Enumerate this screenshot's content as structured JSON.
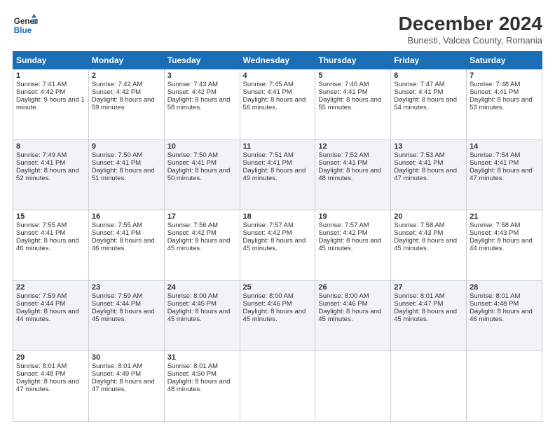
{
  "logo": {
    "line1": "General",
    "line2": "Blue"
  },
  "title": "December 2024",
  "subtitle": "Bunesti, Valcea County, Romania",
  "headers": [
    "Sunday",
    "Monday",
    "Tuesday",
    "Wednesday",
    "Thursday",
    "Friday",
    "Saturday"
  ],
  "weeks": [
    [
      {
        "day": "1",
        "sunrise": "7:41 AM",
        "sunset": "4:42 PM",
        "daylight": "9 hours and 1 minute."
      },
      {
        "day": "2",
        "sunrise": "7:42 AM",
        "sunset": "4:42 PM",
        "daylight": "8 hours and 59 minutes."
      },
      {
        "day": "3",
        "sunrise": "7:43 AM",
        "sunset": "4:42 PM",
        "daylight": "8 hours and 58 minutes."
      },
      {
        "day": "4",
        "sunrise": "7:45 AM",
        "sunset": "4:41 PM",
        "daylight": "8 hours and 56 minutes."
      },
      {
        "day": "5",
        "sunrise": "7:46 AM",
        "sunset": "4:41 PM",
        "daylight": "8 hours and 55 minutes."
      },
      {
        "day": "6",
        "sunrise": "7:47 AM",
        "sunset": "4:41 PM",
        "daylight": "8 hours and 54 minutes."
      },
      {
        "day": "7",
        "sunrise": "7:48 AM",
        "sunset": "4:41 PM",
        "daylight": "8 hours and 53 minutes."
      }
    ],
    [
      {
        "day": "8",
        "sunrise": "7:49 AM",
        "sunset": "4:41 PM",
        "daylight": "8 hours and 52 minutes."
      },
      {
        "day": "9",
        "sunrise": "7:50 AM",
        "sunset": "4:41 PM",
        "daylight": "8 hours and 51 minutes."
      },
      {
        "day": "10",
        "sunrise": "7:50 AM",
        "sunset": "4:41 PM",
        "daylight": "8 hours and 50 minutes."
      },
      {
        "day": "11",
        "sunrise": "7:51 AM",
        "sunset": "4:41 PM",
        "daylight": "8 hours and 49 minutes."
      },
      {
        "day": "12",
        "sunrise": "7:52 AM",
        "sunset": "4:41 PM",
        "daylight": "8 hours and 48 minutes."
      },
      {
        "day": "13",
        "sunrise": "7:53 AM",
        "sunset": "4:41 PM",
        "daylight": "8 hours and 47 minutes."
      },
      {
        "day": "14",
        "sunrise": "7:54 AM",
        "sunset": "4:41 PM",
        "daylight": "8 hours and 47 minutes."
      }
    ],
    [
      {
        "day": "15",
        "sunrise": "7:55 AM",
        "sunset": "4:41 PM",
        "daylight": "8 hours and 46 minutes."
      },
      {
        "day": "16",
        "sunrise": "7:55 AM",
        "sunset": "4:41 PM",
        "daylight": "8 hours and 46 minutes."
      },
      {
        "day": "17",
        "sunrise": "7:56 AM",
        "sunset": "4:42 PM",
        "daylight": "8 hours and 45 minutes."
      },
      {
        "day": "18",
        "sunrise": "7:57 AM",
        "sunset": "4:42 PM",
        "daylight": "8 hours and 45 minutes."
      },
      {
        "day": "19",
        "sunrise": "7:57 AM",
        "sunset": "4:42 PM",
        "daylight": "8 hours and 45 minutes."
      },
      {
        "day": "20",
        "sunrise": "7:58 AM",
        "sunset": "4:43 PM",
        "daylight": "8 hours and 45 minutes."
      },
      {
        "day": "21",
        "sunrise": "7:58 AM",
        "sunset": "4:43 PM",
        "daylight": "8 hours and 44 minutes."
      }
    ],
    [
      {
        "day": "22",
        "sunrise": "7:59 AM",
        "sunset": "4:44 PM",
        "daylight": "8 hours and 44 minutes."
      },
      {
        "day": "23",
        "sunrise": "7:59 AM",
        "sunset": "4:44 PM",
        "daylight": "8 hours and 45 minutes."
      },
      {
        "day": "24",
        "sunrise": "8:00 AM",
        "sunset": "4:45 PM",
        "daylight": "8 hours and 45 minutes."
      },
      {
        "day": "25",
        "sunrise": "8:00 AM",
        "sunset": "4:46 PM",
        "daylight": "8 hours and 45 minutes."
      },
      {
        "day": "26",
        "sunrise": "8:00 AM",
        "sunset": "4:46 PM",
        "daylight": "8 hours and 45 minutes."
      },
      {
        "day": "27",
        "sunrise": "8:01 AM",
        "sunset": "4:47 PM",
        "daylight": "8 hours and 45 minutes."
      },
      {
        "day": "28",
        "sunrise": "8:01 AM",
        "sunset": "4:48 PM",
        "daylight": "8 hours and 46 minutes."
      }
    ],
    [
      {
        "day": "29",
        "sunrise": "8:01 AM",
        "sunset": "4:48 PM",
        "daylight": "8 hours and 47 minutes."
      },
      {
        "day": "30",
        "sunrise": "8:01 AM",
        "sunset": "4:49 PM",
        "daylight": "8 hours and 47 minutes."
      },
      {
        "day": "31",
        "sunrise": "8:01 AM",
        "sunset": "4:50 PM",
        "daylight": "8 hours and 48 minutes."
      },
      null,
      null,
      null,
      null
    ]
  ],
  "labels": {
    "sunrise": "Sunrise:",
    "sunset": "Sunset:",
    "daylight": "Daylight:"
  }
}
